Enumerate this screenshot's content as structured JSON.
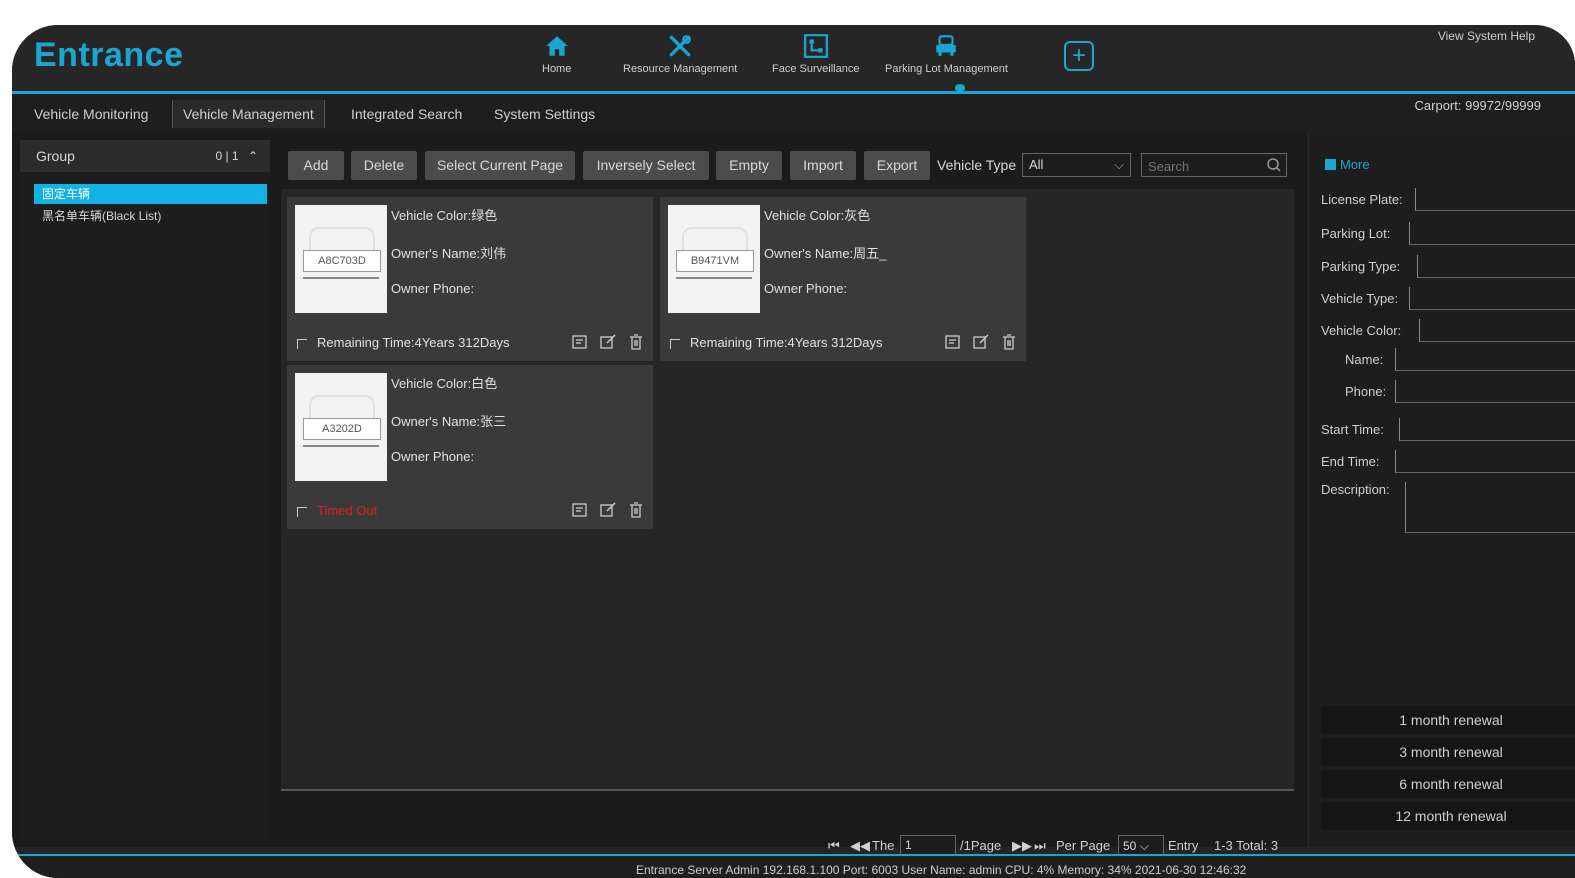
{
  "header": {
    "logo": "Entrance",
    "nav": [
      {
        "label": "Home",
        "icon": "home-icon"
      },
      {
        "label": "Resource Management",
        "icon": "tools-icon"
      },
      {
        "label": "Face Surveillance",
        "icon": "face-scan-icon"
      },
      {
        "label": "Parking Lot Management",
        "icon": "car-icon"
      }
    ],
    "help": "View System Help"
  },
  "tabs": [
    "Vehicle Monitoring",
    "Vehicle Management",
    "Integrated Search",
    "System Settings"
  ],
  "active_tab": "Vehicle Management",
  "carport": "Carport: 99972/99999",
  "group": {
    "title": "Group",
    "count": "0 | 1",
    "items": [
      "固定车辆",
      "黑名单车辆(Black List)"
    ]
  },
  "toolbar": {
    "buttons": [
      "Add",
      "Delete",
      "Select Current Page",
      "Inversely Select",
      "Empty",
      "Import",
      "Export"
    ],
    "vehicle_type_label": "Vehicle Type",
    "vehicle_type_value": "All",
    "search_placeholder": "Search"
  },
  "cards": [
    {
      "plate": "A8C703D",
      "color": "Vehicle Color:绿色",
      "name": "Owner's Name:刘伟",
      "phone": "Owner Phone:",
      "remaining": "Remaining Time:4Years 312Days",
      "timed_out": false
    },
    {
      "plate": "B9471VM",
      "color": "Vehicle Color:灰色",
      "name": "Owner's Name:周五_",
      "phone": "Owner Phone:",
      "remaining": "Remaining Time:4Years 312Days",
      "timed_out": false
    },
    {
      "plate": "A3202D",
      "color": "Vehicle Color:白色",
      "name": "Owner's Name:张三",
      "phone": "Owner Phone:",
      "remaining": "Timed Out",
      "timed_out": true
    }
  ],
  "pager": {
    "the": "The",
    "page_value": "1",
    "page_total": "/1Page",
    "per_page_label": "Per Page",
    "per_page_value": "50",
    "entry": "Entry",
    "summary": "1-3 Total: 3"
  },
  "details": {
    "more": "More",
    "fields": [
      "License Plate:",
      "Parking Lot:",
      "Parking Type:",
      "Vehicle Type:",
      "Vehicle Color:",
      "Name:",
      "Phone:",
      "Start Time:",
      "End Time:",
      "Description:"
    ]
  },
  "renewals": [
    "1 month renewal",
    "3 month renewal",
    "6 month renewal",
    "12 month renewal"
  ],
  "status": "Entrance Server  Admin  192.168.1.100  Port: 6003    User Name: admin    CPU: 4%    Memory: 34%    2021-06-30 12:46:32",
  "colors": {
    "accent": "#1aa6d2",
    "timeout": "#e02020"
  }
}
